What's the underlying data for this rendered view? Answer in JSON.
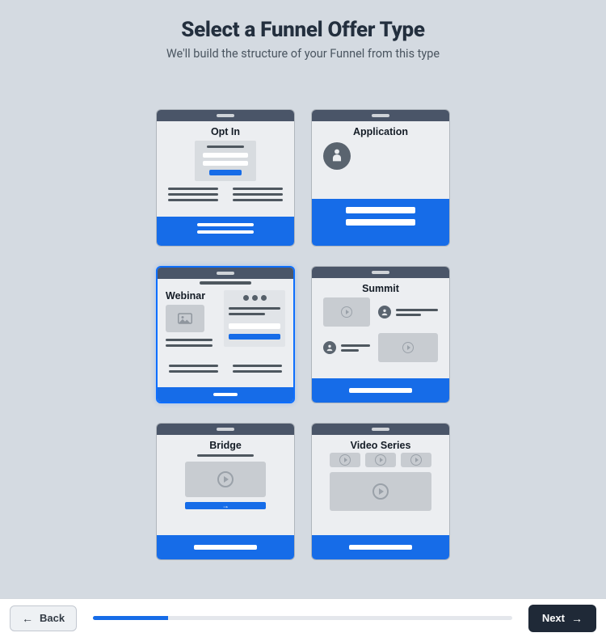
{
  "header": {
    "title": "Select a Funnel Offer Type",
    "subtitle": "We'll build the structure of your Funnel from this type"
  },
  "cards": {
    "opt_in": {
      "label": "Opt In"
    },
    "application": {
      "label": "Application"
    },
    "webinar": {
      "label": "Webinar"
    },
    "summit": {
      "label": "Summit"
    },
    "bridge": {
      "label": "Bridge"
    },
    "video_series": {
      "label": "Video Series"
    }
  },
  "selected_card": "webinar",
  "footer": {
    "back_label": "Back",
    "next_label": "Next",
    "progress_percent": 18
  }
}
